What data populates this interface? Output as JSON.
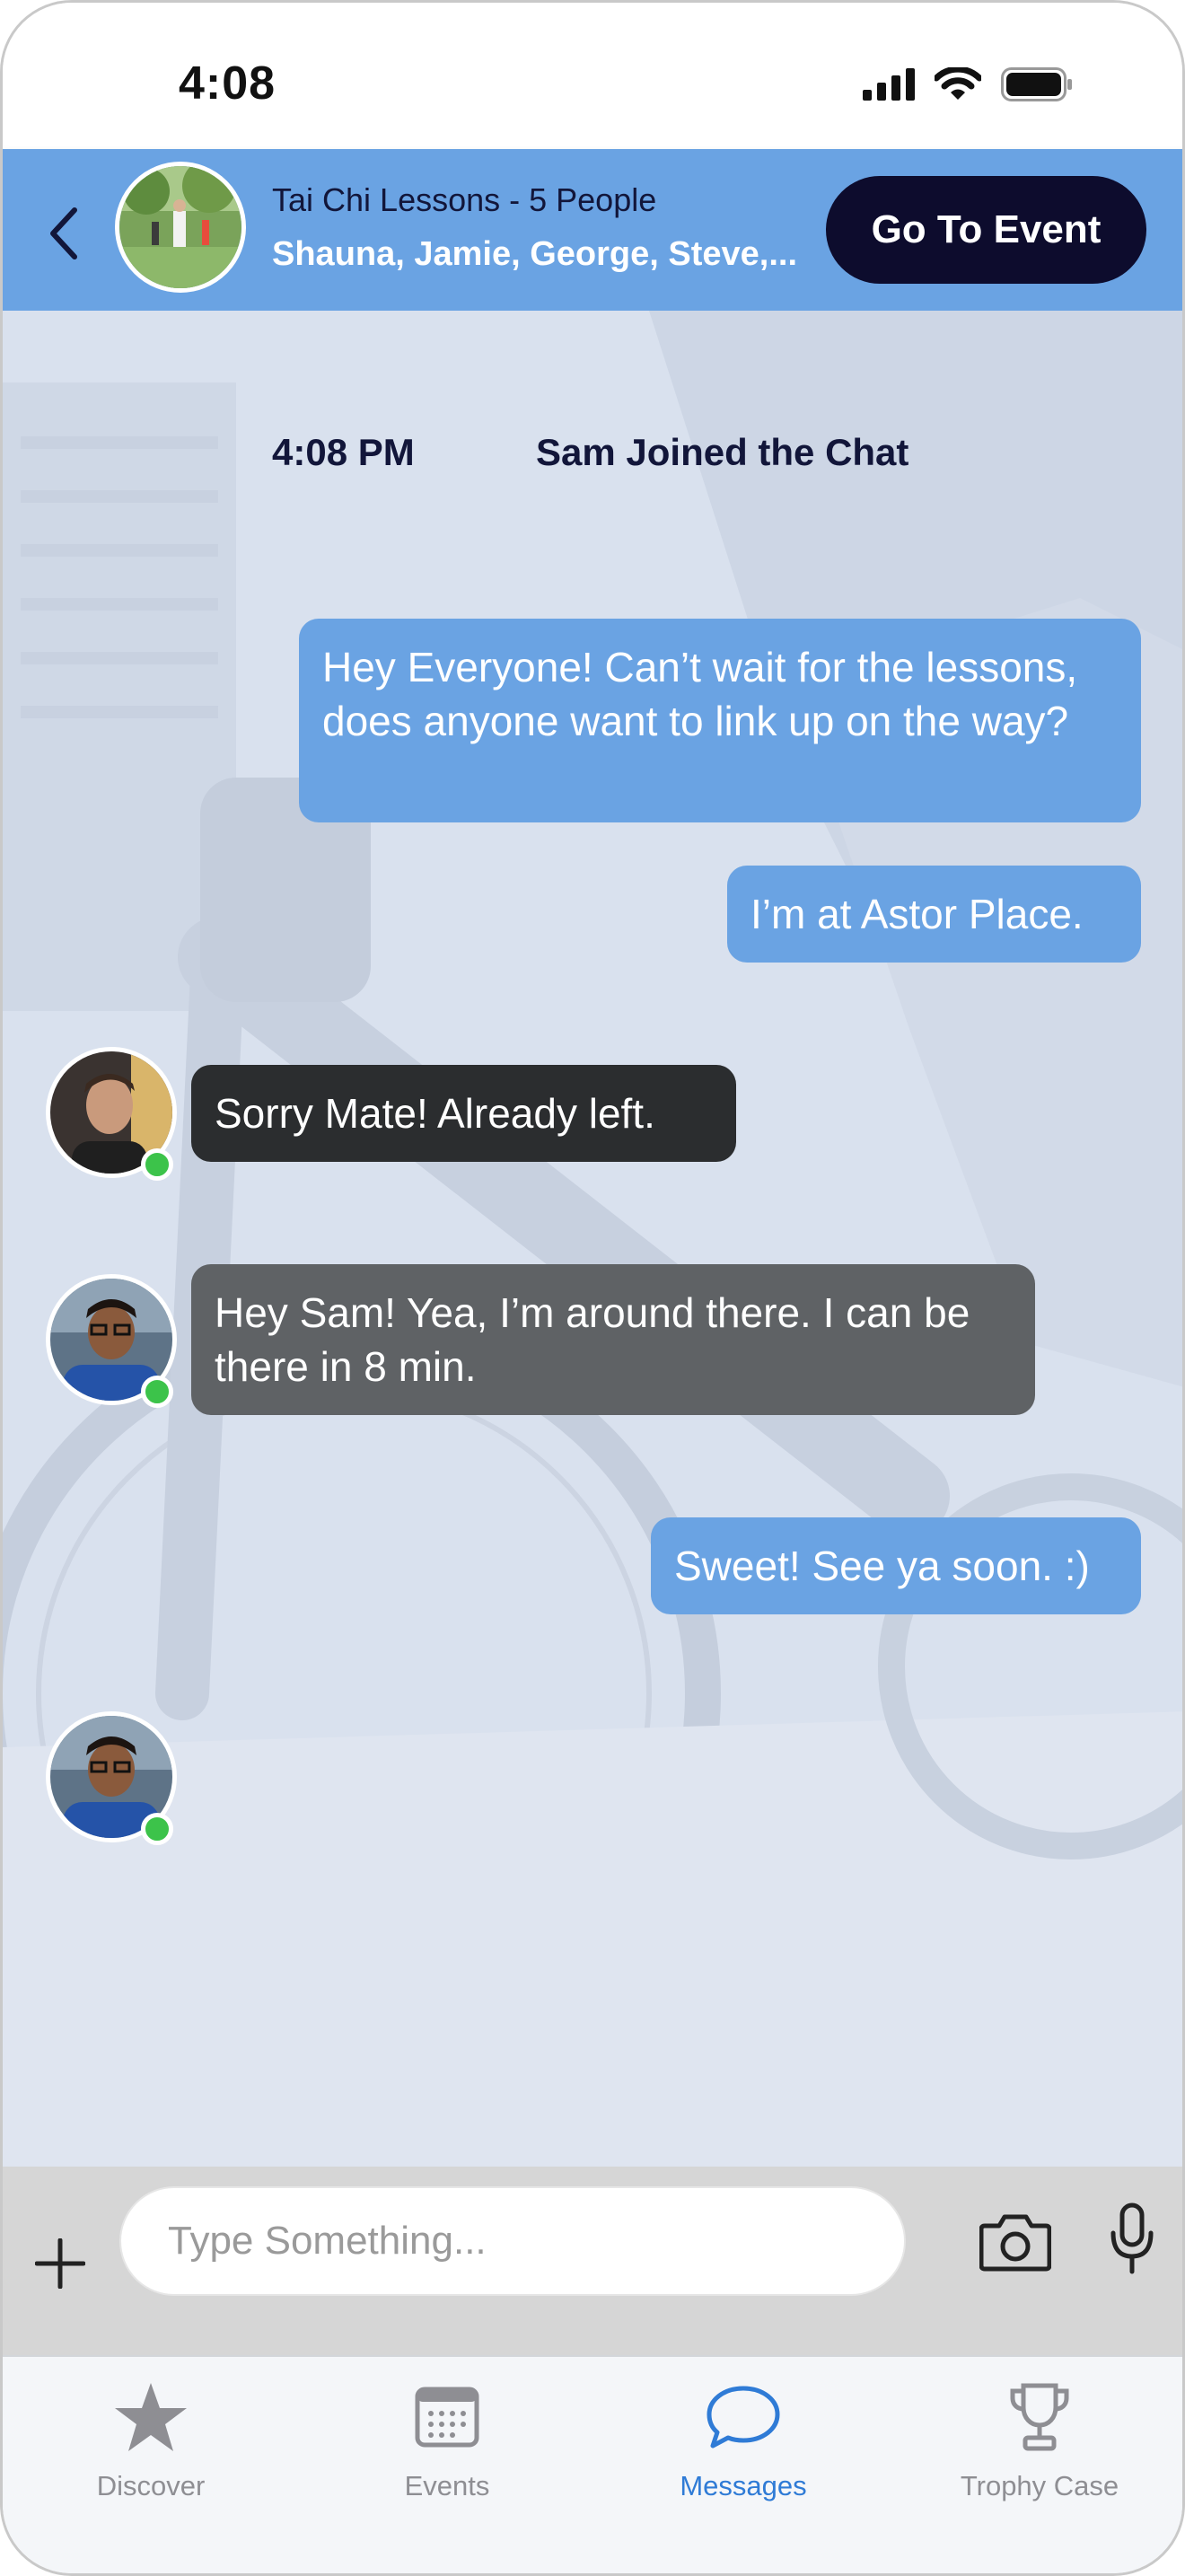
{
  "status_bar": {
    "time": "4:08"
  },
  "header": {
    "title": "Tai Chi Lessons - 5 People",
    "members": "Shauna, Jamie, George, Steve,...",
    "go_to_event_label": "Go To Event"
  },
  "chat": {
    "system_message": {
      "time": "4:08 PM",
      "text": "Sam Joined the Chat"
    },
    "messages": [
      {
        "direction": "outgoing",
        "text": "Hey Everyone! Can’t wait for the lessons, does anyone want to link up on the way?"
      },
      {
        "direction": "outgoing",
        "text": "I’m at Astor Place."
      },
      {
        "direction": "incoming",
        "sender_online": true,
        "text": "Sorry Mate! Already left."
      },
      {
        "direction": "incoming",
        "sender_online": true,
        "text": "Hey Sam! Yea, I’m around there. I can be there in 8 min."
      },
      {
        "direction": "outgoing",
        "text": "Sweet! See ya soon. :)"
      },
      {
        "direction": "incoming",
        "sender_online": true,
        "text": ""
      }
    ]
  },
  "composer": {
    "placeholder": "Type Something...",
    "value": ""
  },
  "tab_bar": {
    "tabs": [
      {
        "label": "Discover",
        "icon": "star-icon",
        "active": false
      },
      {
        "label": "Events",
        "icon": "calendar-icon",
        "active": false
      },
      {
        "label": "Messages",
        "icon": "chat-bubble-icon",
        "active": true
      },
      {
        "label": "Trophy Case",
        "icon": "trophy-icon",
        "active": false
      }
    ]
  },
  "colors": {
    "header_blue": "#6aa3e3",
    "outgoing_bubble": "#6aa3e3",
    "incoming_dark": "#2b2d2f",
    "incoming_gray": "#5f6265",
    "button_navy": "#0d0c2d",
    "online_green": "#3cc34a",
    "active_tab": "#2f7bd6"
  }
}
